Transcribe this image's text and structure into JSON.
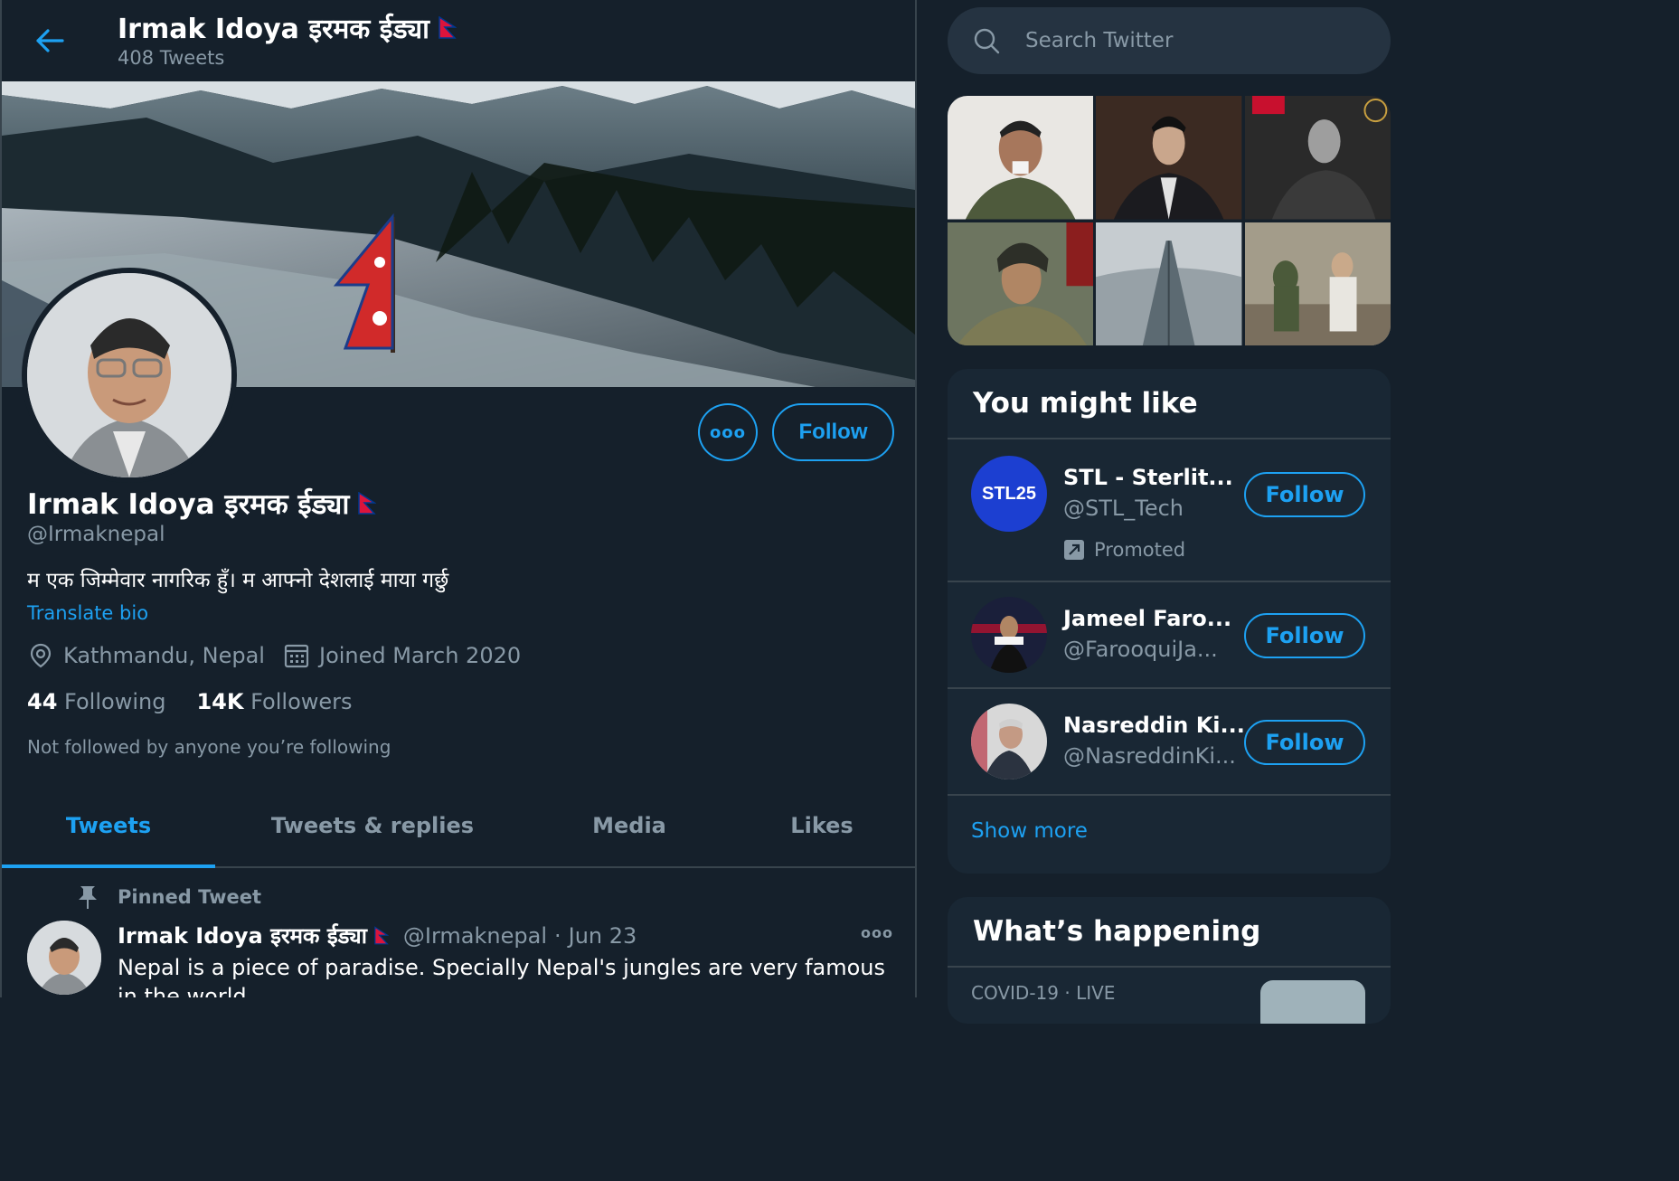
{
  "header": {
    "title": "Irmak Idoya इरमक ईड्या",
    "tweet_count": "408 Tweets"
  },
  "profile": {
    "name": "Irmak Idoya इरमक ईड्या",
    "handle": "@Irmaknepal",
    "bio": "म एक जिम्मेवार नागरिक हुँ। म आफ्नो देशलाई माया गर्छु",
    "translate_label": "Translate bio",
    "location": "Kathmandu, Nepal",
    "joined": "Joined March 2020",
    "following_count": "44",
    "following_label": "Following",
    "followers_count": "14K",
    "followers_label": "Followers",
    "not_followed": "Not followed by anyone you’re following",
    "follow_label": "Follow"
  },
  "tabs": [
    "Tweets",
    "Tweets & replies",
    "Media",
    "Likes"
  ],
  "pinned": {
    "label": "Pinned Tweet",
    "name": "Irmak Idoya इरमक ईड्या",
    "handle": "@Irmaknepal",
    "separator": "·",
    "date": "Jun 23",
    "text": "Nepal is a piece of paradise. Specially Nepal's jungles are very famous in the world."
  },
  "search": {
    "placeholder": "Search Twitter"
  },
  "you_might_like": {
    "title": "You might like",
    "accounts": [
      {
        "name": "STL - Sterlit...",
        "handle": "@STL_Tech",
        "promoted": "Promoted",
        "follow": "Follow",
        "avatar_text": "STL25"
      },
      {
        "name": "Jameel Faro...",
        "handle": "@FarooquiJa...",
        "follow": "Follow"
      },
      {
        "name": "Nasreddin Ki...",
        "handle": "@NasreddinKi...",
        "follow": "Follow"
      }
    ],
    "show_more": "Show more"
  },
  "whats_happening": {
    "title": "What’s happening",
    "first_item_meta": "COVID-19 · LIVE"
  },
  "colors": {
    "accent": "#1da1f2",
    "bg": "#15202b",
    "card": "#192734",
    "muted": "#8899a6",
    "border": "#38444d"
  }
}
